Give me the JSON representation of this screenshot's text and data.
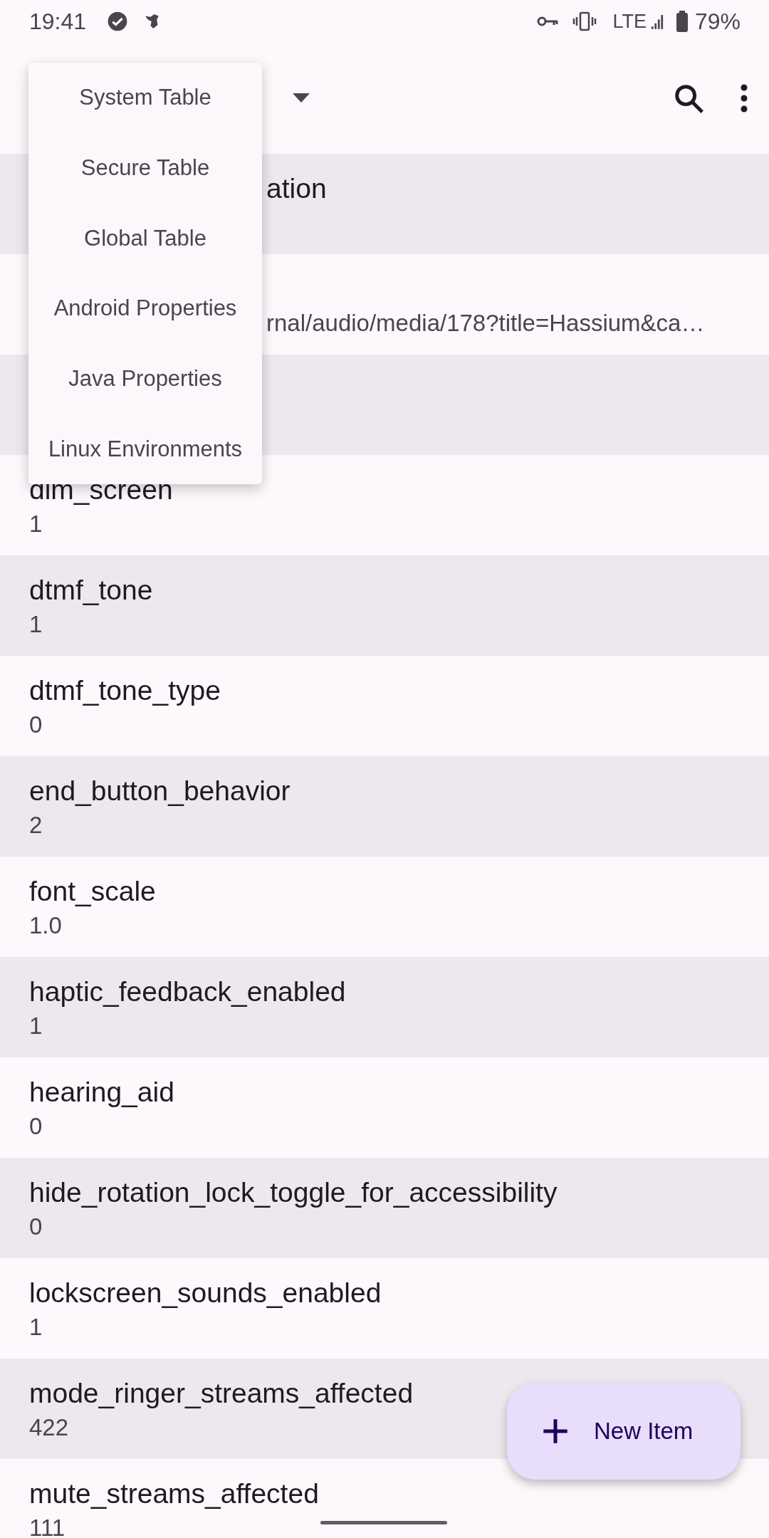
{
  "status_bar": {
    "time": "19:41",
    "network": "LTE",
    "battery": "79%"
  },
  "dropdown_menu": {
    "items": [
      {
        "label": "System Table"
      },
      {
        "label": "Secure Table"
      },
      {
        "label": "Global Table"
      },
      {
        "label": "Android Properties"
      },
      {
        "label": "Java Properties"
      },
      {
        "label": "Linux Environments"
      }
    ]
  },
  "rows": [
    {
      "kind": "covered",
      "name": "ation"
    },
    {
      "kind": "covered",
      "value": "rnal/audio/media/178?title=Hassium&ca…"
    },
    {
      "kind": "covered"
    },
    {
      "kind": "plain",
      "name": "dim_screen",
      "value": "1"
    },
    {
      "kind": "plain",
      "name": "dtmf_tone",
      "value": "1"
    },
    {
      "kind": "plain",
      "name": "dtmf_tone_type",
      "value": "0"
    },
    {
      "kind": "plain",
      "name": "end_button_behavior",
      "value": "2"
    },
    {
      "kind": "plain",
      "name": "font_scale",
      "value": "1.0"
    },
    {
      "kind": "plain",
      "name": "haptic_feedback_enabled",
      "value": "1"
    },
    {
      "kind": "plain",
      "name": "hearing_aid",
      "value": "0"
    },
    {
      "kind": "plain",
      "name": "hide_rotation_lock_toggle_for_accessibility",
      "value": "0"
    },
    {
      "kind": "plain",
      "name": "lockscreen_sounds_enabled",
      "value": "1"
    },
    {
      "kind": "plain",
      "name": "mode_ringer_streams_affected",
      "value": "422"
    },
    {
      "kind": "plain",
      "name": "mute_streams_affected",
      "value": "111"
    }
  ],
  "fab": {
    "label": "New Item"
  }
}
